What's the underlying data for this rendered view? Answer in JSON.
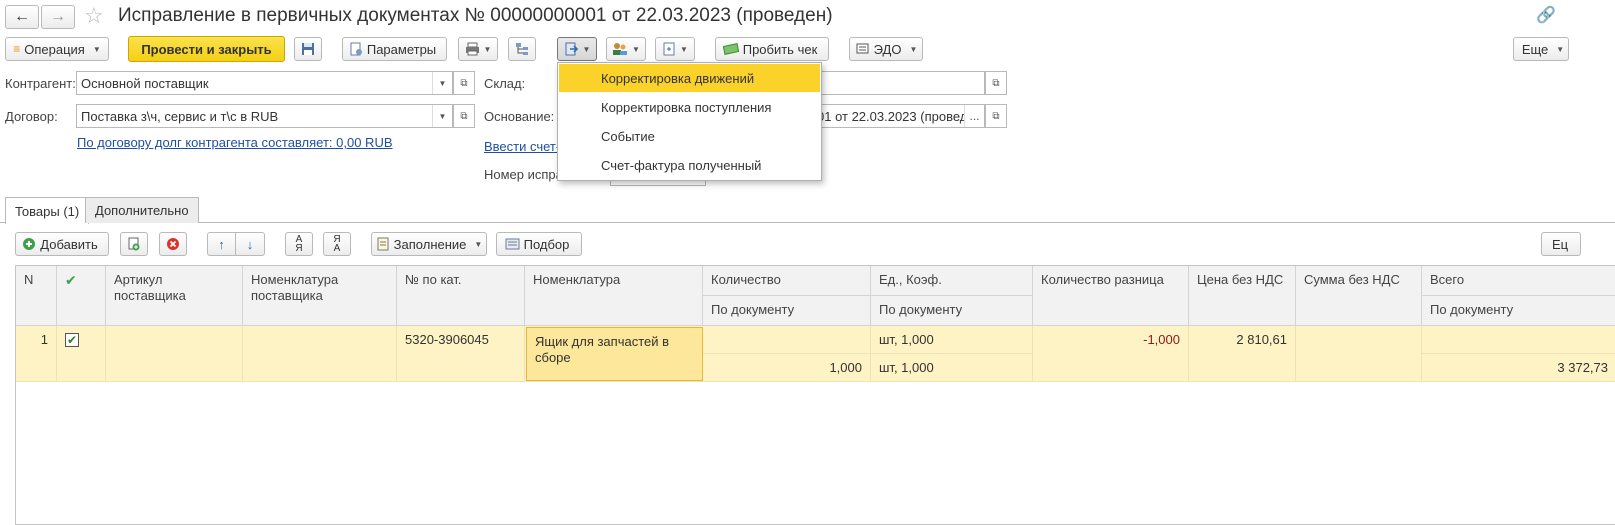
{
  "window": {
    "title": "Исправление в первичных документах № 00000000001 от 22.03.2023 (проведен)"
  },
  "toolbar": {
    "operation": "Операция",
    "post_close": "Провести и закрыть",
    "params": "Параметры",
    "check": "Пробить чек",
    "edo": "ЭДО",
    "more": "Еще"
  },
  "dropdown_menu": {
    "items": [
      "Корректировка движений",
      "Корректировка поступления",
      "Событие",
      "Счет-фактура полученный"
    ],
    "selected": "Корректировка движений"
  },
  "form": {
    "counterparty_label": "Контрагент:",
    "counterparty_value": "Основной поставщик",
    "contract_label": "Договор:",
    "contract_value": "Поставка з\\ч, сервис и т\\с в RUB",
    "debt_link": "По договору долг контрагента составляет: 0,00 RUB",
    "warehouse_label": "Склад:",
    "basis_label": "Основание:",
    "basis_value": "01 от 22.03.2023 (провед",
    "basis_more": "...",
    "invoice_link": "Ввести счет-",
    "correction_number_label": "Номер испра"
  },
  "tabs": [
    "Товары (1)",
    "Дополнительно"
  ],
  "table_toolbar": {
    "add": "Добавить",
    "fill": "Заполнение",
    "pick": "Подбор",
    "more_clipped": "Ец"
  },
  "table": {
    "headers": {
      "n": "N",
      "article": "Артикул поставщика",
      "supplier_nom": "Номенклатура поставщика",
      "cat_no": "№ по кат.",
      "nomenclature": "Номенклатура",
      "quantity": "Количество",
      "quantity_sub": "По документу",
      "unit": "Ед., Коэф.",
      "unit_sub": "По документу",
      "qty_diff": "Количество разница",
      "price": "Цена без НДС",
      "sum": "Сумма без НДС",
      "total": "Всего",
      "total_sub": "По документу"
    },
    "rows": [
      {
        "n": "1",
        "checked": true,
        "article": "",
        "supplier_nom": "",
        "cat_no": "5320-3906045",
        "nomenclature": "Ящик для запчастей в сборе",
        "quantity": "",
        "quantity_doc": "1,000",
        "unit": "шт, 1,000",
        "unit_doc": "шт, 1,000",
        "qty_diff": "-1,000",
        "price": "2 810,61",
        "sum": "",
        "total": "",
        "total_doc": "3 372,73"
      }
    ]
  },
  "colors": {
    "accent_yellow": "#fbd22a",
    "row_highlight": "#fdf3c4",
    "selected_cell": "#fce79a",
    "link_blue": "#1f4f9f"
  }
}
